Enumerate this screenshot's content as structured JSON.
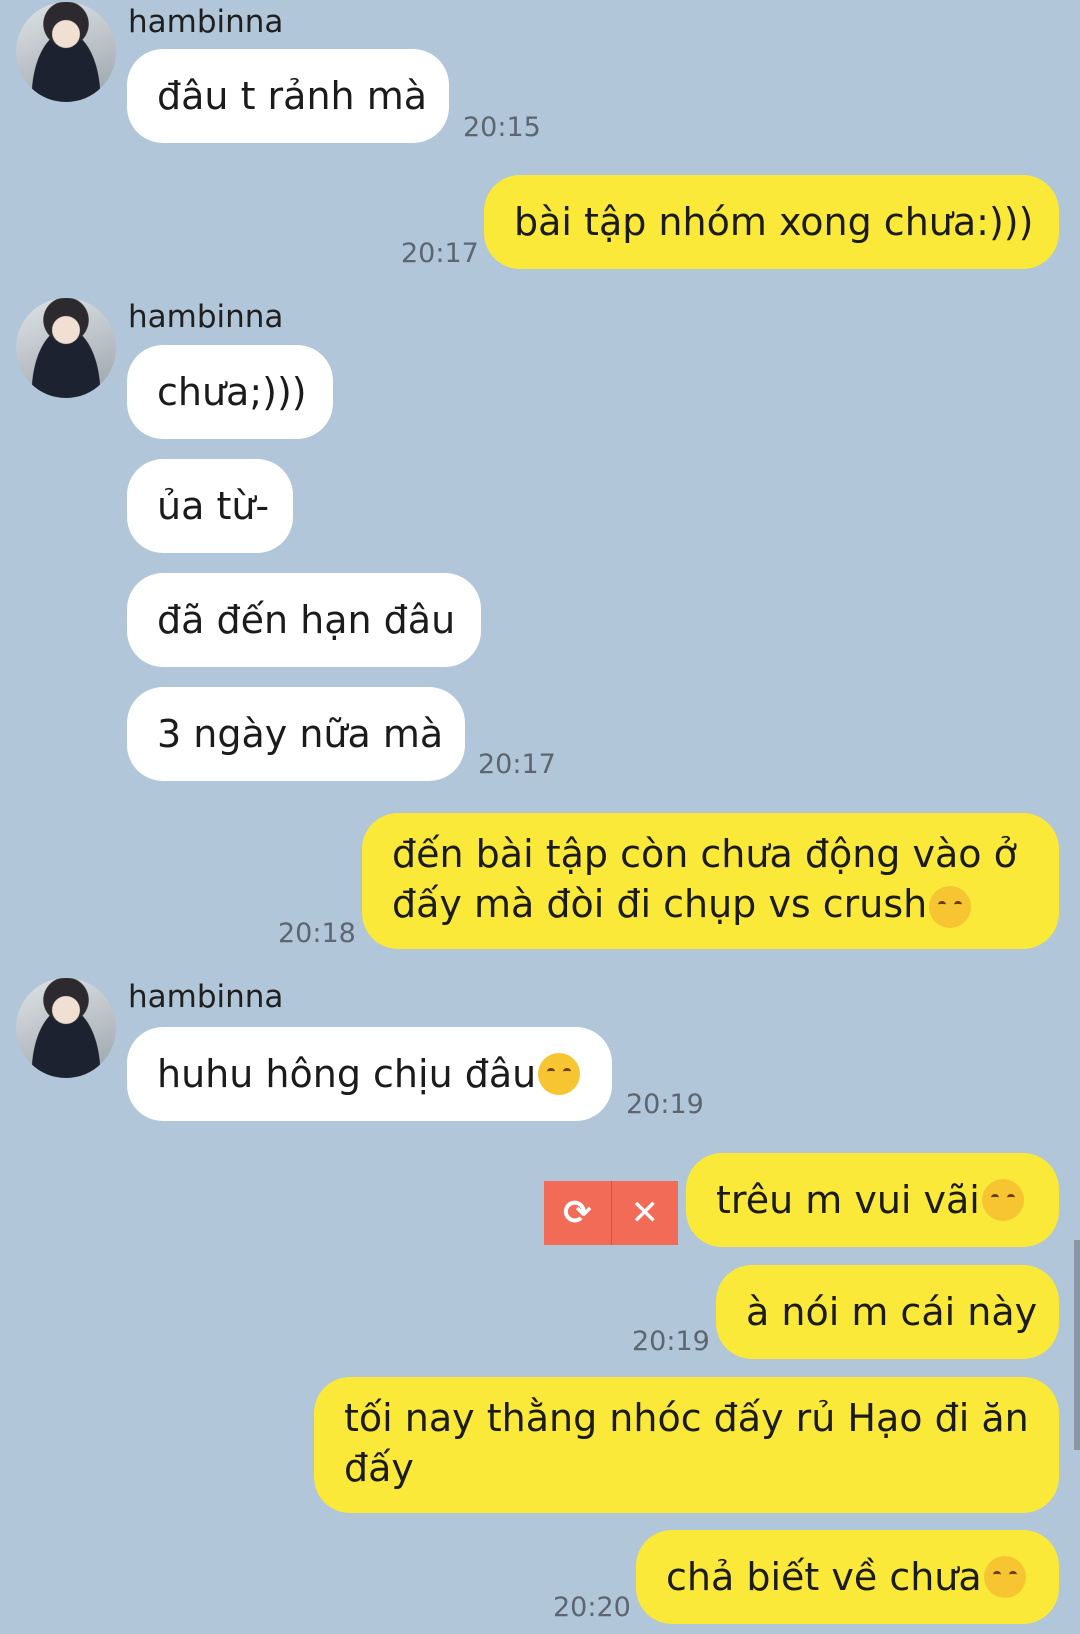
{
  "sender_name": "hambinna",
  "messages": {
    "m1": {
      "text": "đâu t rảnh mà",
      "time": "20:15"
    },
    "m2": {
      "text": "bài tập nhóm xong chưa:)))",
      "time": "20:17"
    },
    "m3": {
      "text": "chưa;)))"
    },
    "m4": {
      "text": "ủa từ-"
    },
    "m5": {
      "text": "đã đến hạn đâu"
    },
    "m6": {
      "text": "3 ngày nữa mà",
      "time": "20:17"
    },
    "m7": {
      "line1": "đến bài tập còn chưa động vào ở",
      "line2": "đấy mà đòi đi chụp vs crush",
      "time": "20:18"
    },
    "m8": {
      "text": "huhu hông chịu đâu",
      "time": "20:19"
    },
    "m9": {
      "text": "trêu m vui vãi "
    },
    "m10": {
      "text": "à nói m cái này",
      "time": "20:19"
    },
    "m11": {
      "line1": "tối nay thằng nhóc đấy rủ Hạo đi ăn",
      "line2": "đấy"
    },
    "m12": {
      "text": "chả biết về chưa",
      "time": "20:20"
    }
  },
  "failed_send": {
    "retry_icon": "retry-icon",
    "delete_icon": "close-icon"
  },
  "icons": {
    "m7": "smirk-emoji",
    "m8": "crying-emoji",
    "m9": "rofl-emoji",
    "m12": "relieved-emoji"
  },
  "colors": {
    "background": "#b1c6d9",
    "outgoing": "#fbe939",
    "incoming": "#ffffff",
    "failed": "#f26b57"
  }
}
